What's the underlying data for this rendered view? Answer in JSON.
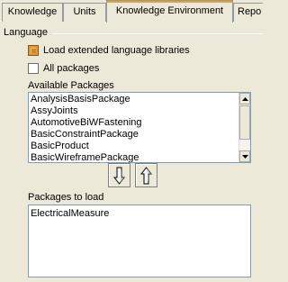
{
  "tabs": [
    {
      "label": "Knowledge",
      "active": false
    },
    {
      "label": "Units",
      "active": false
    },
    {
      "label": "Knowledge Environment",
      "active": true
    },
    {
      "label": "Repo",
      "active": false
    }
  ],
  "group": {
    "label": "Language"
  },
  "options": {
    "load_extended": {
      "label": "Load extended language libraries",
      "checked": true
    },
    "all_packages": {
      "label": "All packages",
      "checked": false
    }
  },
  "available": {
    "label": "Available Packages",
    "items": [
      "AnalysisBasisPackage",
      "AssyJoints",
      "AutomotiveBiWFastening",
      "BasicConstraintPackage",
      "BasicProduct",
      "BasicWireframePackage"
    ]
  },
  "buttons": {
    "move_down_icon": "arrow-down-icon",
    "move_up_icon": "arrow-up-icon"
  },
  "to_load": {
    "label": "Packages to load",
    "items": [
      "ElectricalMeasure"
    ]
  },
  "colors": {
    "background": "#ece9d8",
    "tab_accent": "#e3a13a",
    "list_border": "#7f9db9"
  }
}
